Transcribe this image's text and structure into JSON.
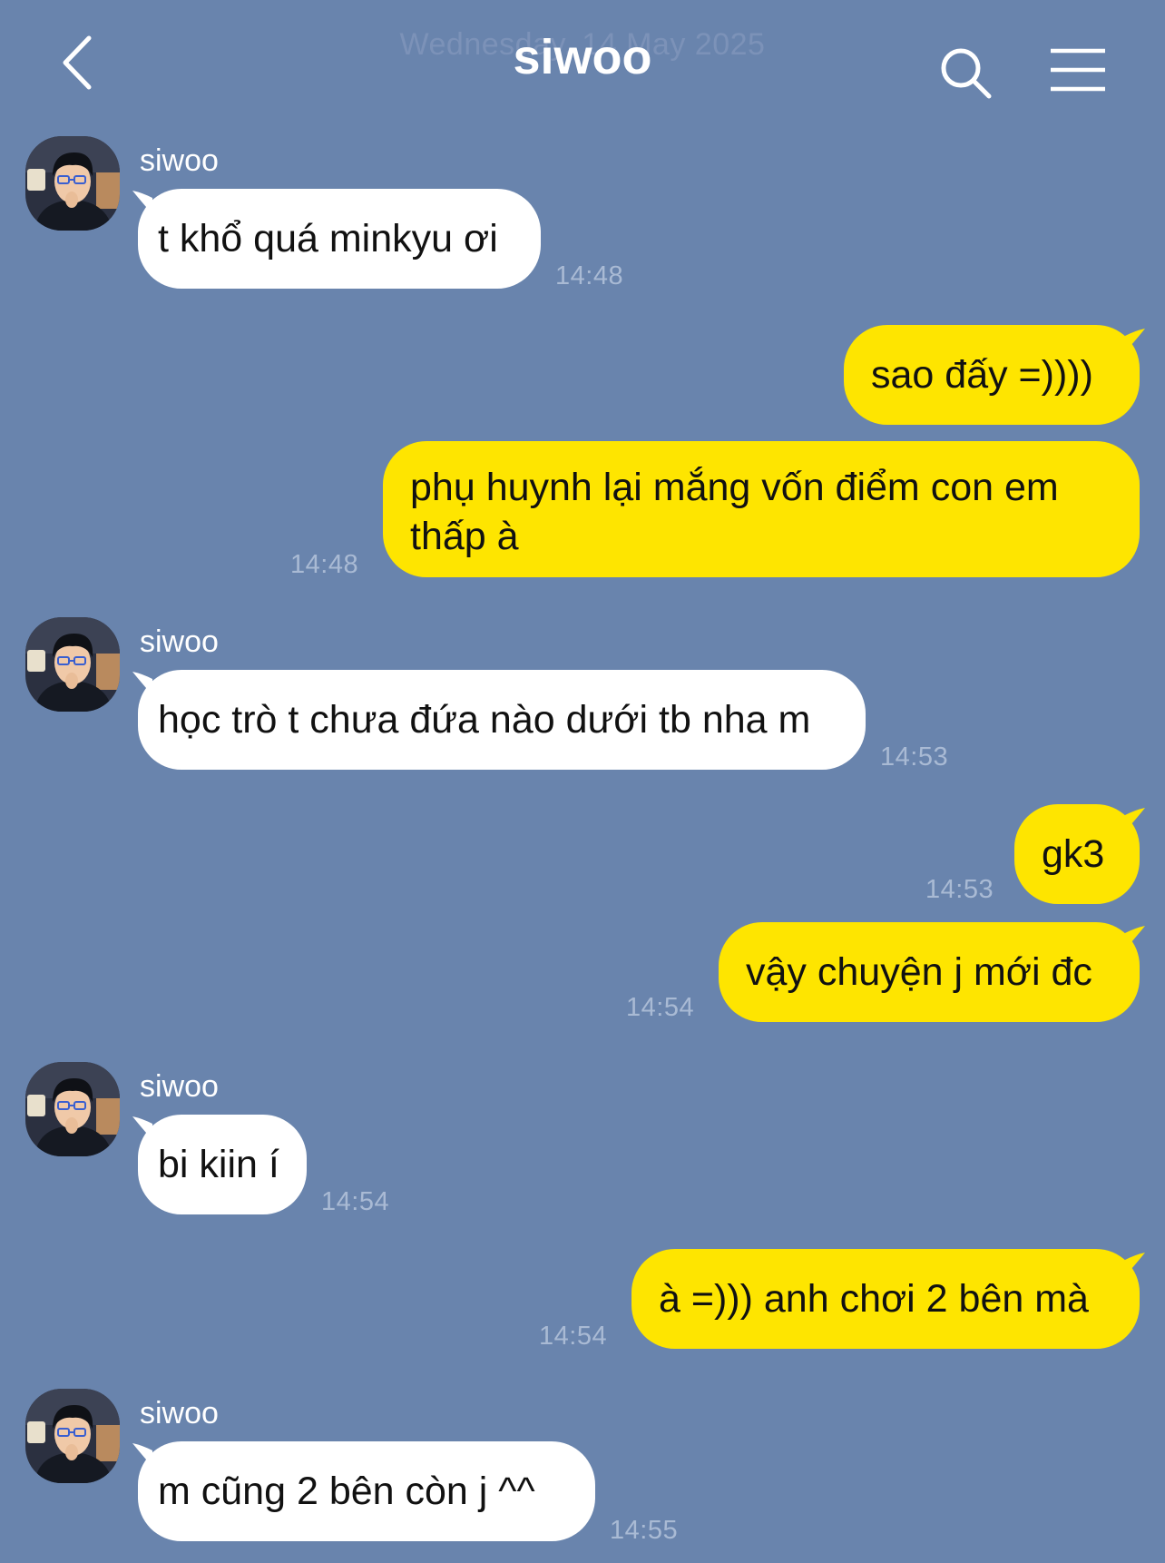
{
  "header": {
    "title": "siwoo",
    "date_overlay": "Wednesday, 14 May 2025",
    "icons": {
      "back": "chevron-left-icon",
      "search": "search-icon",
      "menu": "hamburger-menu-icon"
    }
  },
  "colors": {
    "background": "#6984ad",
    "incoming_bubble": "#ffffff",
    "outgoing_bubble": "#fee500",
    "time_text": "#a9bad4"
  },
  "messages": [
    {
      "sender": "siwoo",
      "text": "t khổ quá minkyu ơi",
      "time": "14:48"
    },
    {
      "text": "sao đấy =))))"
    },
    {
      "text": "phụ huynh lại mắng vốn điểm con em thấp à",
      "time": "14:48"
    },
    {
      "sender": "siwoo",
      "text": "học trò t chưa đứa nào dưới tb nha m",
      "time": "14:53"
    },
    {
      "text": "gk3",
      "time": "14:53"
    },
    {
      "text": "vậy chuyện j mới đc",
      "time": "14:54"
    },
    {
      "sender": "siwoo",
      "text": "bi kiin í",
      "time": "14:54"
    },
    {
      "text": "à =))) anh chơi 2 bên mà",
      "time": "14:54"
    },
    {
      "sender": "siwoo",
      "text": "m cũng 2 bên còn j ^^",
      "time": "14:55"
    }
  ]
}
